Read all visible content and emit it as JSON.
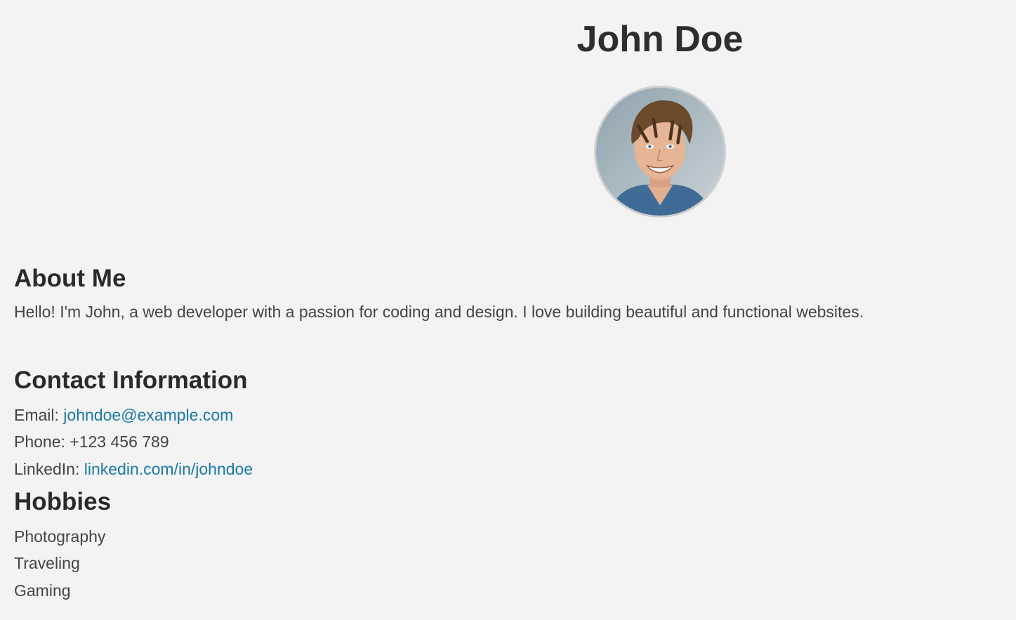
{
  "profile": {
    "name": "John Doe",
    "avatar_alt": "profile photo"
  },
  "about": {
    "heading": "About Me",
    "text": "Hello! I'm John, a web developer with a passion for coding and design. I love building beautiful and functional websites."
  },
  "contact": {
    "heading": "Contact Information",
    "email_label": "Email:",
    "email_value": "johndoe@example.com",
    "phone_label": "Phone:",
    "phone_value": "+123 456 789",
    "linkedin_label": "LinkedIn:",
    "linkedin_value": "linkedin.com/in/johndoe"
  },
  "hobbies": {
    "heading": "Hobbies",
    "items": [
      "Photography",
      "Traveling",
      "Gaming"
    ]
  },
  "colors": {
    "background": "#f3f3f3",
    "heading": "#2a2a2a",
    "text": "#444444",
    "link": "#1a78a8"
  }
}
